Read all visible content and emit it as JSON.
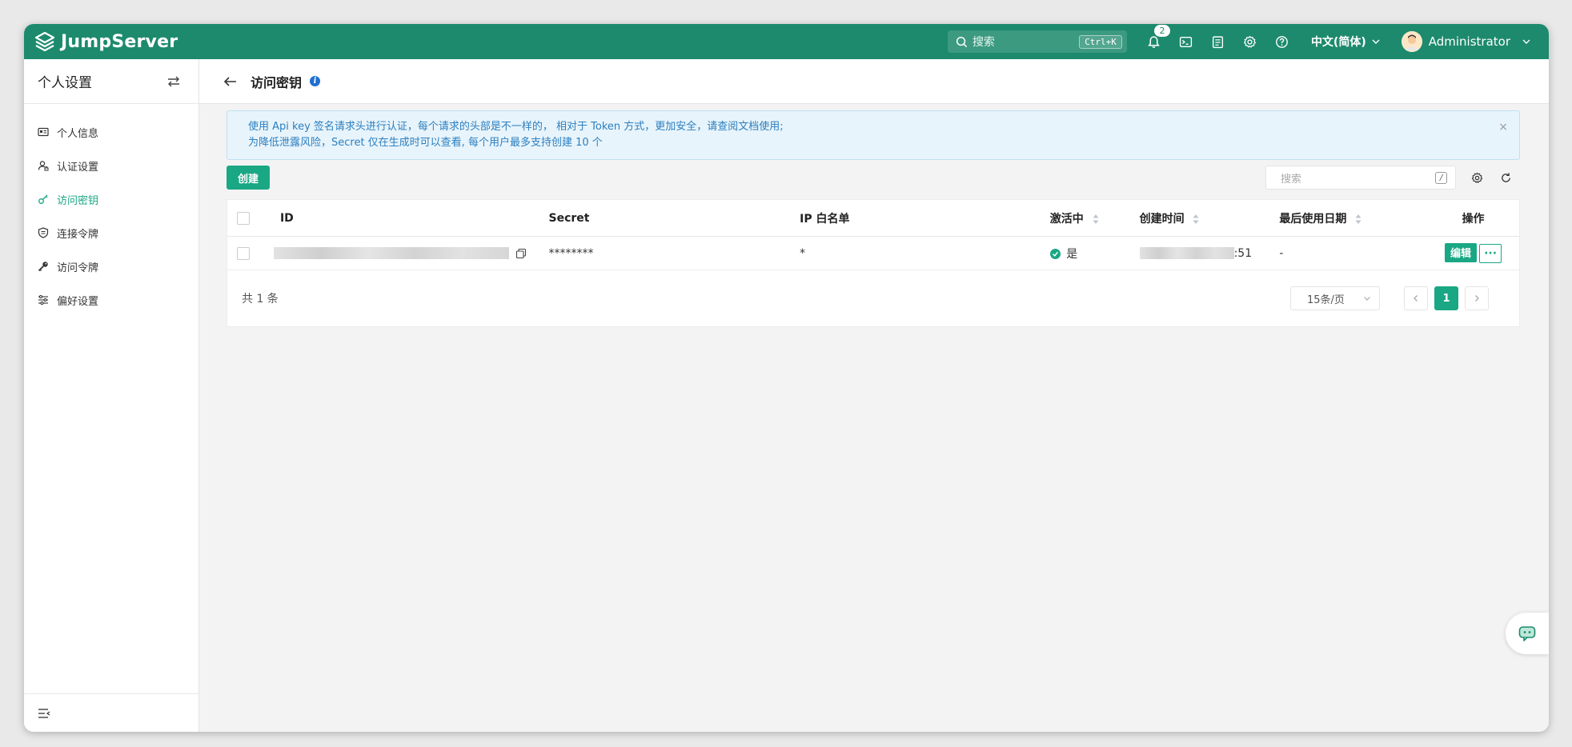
{
  "app": {
    "name": "JumpServer"
  },
  "topbar": {
    "search_placeholder": "搜索",
    "search_shortcut": "Ctrl+K",
    "notification_count": "2",
    "language": "中文(简体)",
    "username": "Administrator",
    "icons": [
      "search-icon",
      "bell-icon",
      "terminal-icon",
      "clipboard-icon",
      "gear-icon",
      "help-icon",
      "chevron-down-icon"
    ]
  },
  "sidebar": {
    "title": "个人设置",
    "items": [
      {
        "label": "个人信息",
        "icon": "id-card-icon",
        "active": false
      },
      {
        "label": "认证设置",
        "icon": "user-lock-icon",
        "active": false
      },
      {
        "label": "访问密钥",
        "icon": "key-icon",
        "active": true
      },
      {
        "label": "连接令牌",
        "icon": "shield-icon",
        "active": false
      },
      {
        "label": "访问令牌",
        "icon": "key-solid-icon",
        "active": false
      },
      {
        "label": "偏好设置",
        "icon": "sliders-icon",
        "active": false
      }
    ]
  },
  "page": {
    "title": "访问密钥"
  },
  "alert": {
    "line1": "使用 Api key 签名请求头进行认证，每个请求的头部是不一样的， 相对于 Token 方式，更加安全，请查阅文档使用;",
    "line2": "为降低泄露风险，Secret 仅在生成时可以查看, 每个用户最多支持创建 10 个",
    "close": "×"
  },
  "toolbar": {
    "create_label": "创建",
    "search_placeholder": "搜索",
    "search_shortcut": "/"
  },
  "table": {
    "columns": {
      "id": "ID",
      "secret": "Secret",
      "ip": "IP 白名单",
      "active": "激活中",
      "created": "创建时间",
      "last_used": "最后使用日期",
      "ops": "操作"
    },
    "rows": [
      {
        "secret": "********",
        "ip": "*",
        "active": "是",
        "created_suffix": ":51",
        "last_used": "-",
        "edit_label": "编辑",
        "more_label": "···"
      }
    ]
  },
  "pager": {
    "total": "共 1 条",
    "page_size": "15条/页",
    "current_page": "1"
  },
  "colors": {
    "brand": "#1d8a6d",
    "accent": "#1aa784",
    "info": "#2b7fc0"
  }
}
